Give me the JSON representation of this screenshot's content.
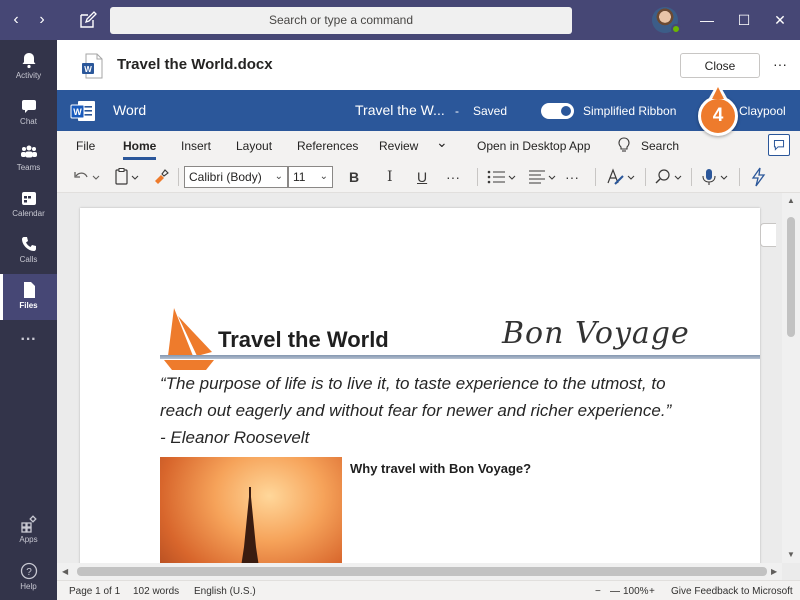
{
  "topbar": {
    "search_placeholder": "Search or type a command",
    "back_icon": "chevron-left-icon",
    "forward_icon": "chevron-right-icon",
    "compose_icon": "compose-icon",
    "min_symbol": "—",
    "max_symbol": "☐",
    "close_symbol": "✕"
  },
  "rail": {
    "items": [
      {
        "label": "Activity",
        "icon": "bell-icon"
      },
      {
        "label": "Chat",
        "icon": "chat-icon"
      },
      {
        "label": "Teams",
        "icon": "teams-icon"
      },
      {
        "label": "Calendar",
        "icon": "calendar-icon"
      },
      {
        "label": "Calls",
        "icon": "phone-icon"
      },
      {
        "label": "Files",
        "icon": "file-icon"
      }
    ],
    "more": "···",
    "apps": "Apps",
    "help": "Help"
  },
  "doc_header": {
    "title": "Travel the World.docx",
    "close_label": "Close",
    "more": "···"
  },
  "word_bar": {
    "app_name": "Word",
    "doc_name": "Travel the W...",
    "dash": "-",
    "saved": "Saved",
    "toggle_label": "Simplified Ribbon",
    "account": "Claypool"
  },
  "callout": {
    "number": "4"
  },
  "tabs": {
    "file": "File",
    "home": "Home",
    "insert": "Insert",
    "layout": "Layout",
    "references": "References",
    "review": "Review",
    "more": "⌄",
    "open_desktop": "Open in Desktop App",
    "search": "Search"
  },
  "toolbar": {
    "font": "Calibri (Body)",
    "size": "11",
    "bold": "B",
    "italic": "I",
    "underline": "U",
    "more": "···"
  },
  "document": {
    "heading": "Travel the World",
    "script_title": "Bon Voyage",
    "quote": "“The purpose of life is to live it, to taste experience to the utmost, to reach out eagerly and without fear for newer and richer experience.” - Eleanor Roosevelt",
    "section_heading": "Why travel with Bon Voyage?"
  },
  "status": {
    "page": "Page 1 of 1",
    "words": "102 words",
    "language": "English (U.S.)",
    "zoom_minus": "−",
    "zoom": "100%",
    "zoom_plus": "+",
    "feedback": "Give Feedback to Microsoft"
  },
  "colors": {
    "teams_purple": "#464775",
    "rail_dark": "#33344a",
    "word_blue": "#2b579a",
    "callout_orange": "#ee7b2c"
  }
}
